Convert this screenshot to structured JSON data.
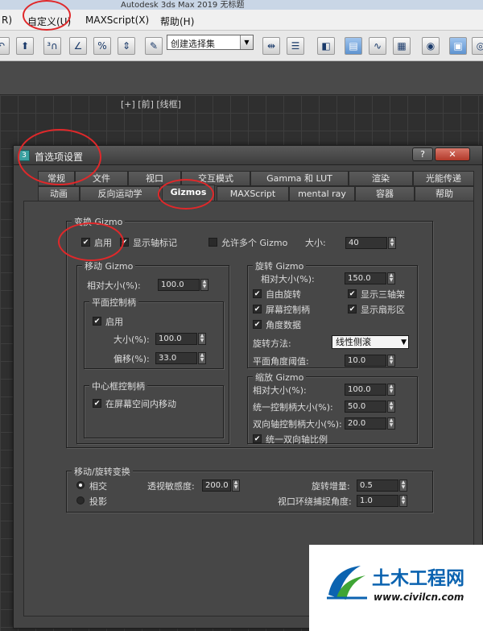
{
  "app": {
    "window_title": "Autodesk 3ds Max 2019    无标题"
  },
  "menubar": {
    "items": [
      "R)",
      "自定义(U)",
      "MAXScript(X)",
      "帮助(H)"
    ]
  },
  "toolbar": {
    "selection_set_value": "创建选择集",
    "icons": [
      "undo-icon",
      "upload-icon",
      "snap-3-icon",
      "angle-snap-icon",
      "percent-snap-icon",
      "spinner-snap-icon",
      "edit-named-selection-icon",
      "mirror-icon",
      "align-icon",
      "layer-icon",
      "scene-explorer-icon",
      "curve-editor-icon",
      "schematic-icon",
      "material-editor-icon",
      "render-setup-icon",
      "render-icon"
    ]
  },
  "viewport": {
    "label": "[+] [前] [线框]"
  },
  "dialog": {
    "title": "首选项设置",
    "help_button": "?",
    "close_button": "✕",
    "tabs_row1": [
      "常规",
      "文件",
      "视口",
      "交互模式",
      "Gamma 和 LUT",
      "渲染",
      "光能传递"
    ],
    "tabs_row2": [
      "动画",
      "反向运动学",
      "Gizmos",
      "MAXScript",
      "mental ray",
      "容器",
      "帮助"
    ],
    "active_tab": "Gizmos",
    "transform_gizmo": {
      "group_label": "变换 Gizmo",
      "enable_label": "启用",
      "enable_checked": true,
      "show_axis_label": "显示轴标记",
      "show_axis_checked": true,
      "allow_multiple_label": "允许多个 Gizmo",
      "allow_multiple_checked": false,
      "size_label": "大小:",
      "size_value": "40"
    },
    "move_gizmo": {
      "group_label": "移动 Gizmo",
      "relative_size_label": "相对大小(%):",
      "relative_size_value": "100.0",
      "plane_handles": {
        "group_label": "平面控制柄",
        "enable_label": "启用",
        "enable_checked": true,
        "size_label": "大小(%):",
        "size_value": "100.0",
        "offset_label": "偏移(%):",
        "offset_value": "33.0"
      },
      "center_handle": {
        "group_label": "中心框控制柄",
        "screen_space_label": "在屏幕空间内移动",
        "screen_space_checked": true
      }
    },
    "rotate_gizmo": {
      "group_label": "旋转 Gizmo",
      "relative_size_label": "相对大小(%):",
      "relative_size_value": "150.0",
      "free_rotate_label": "自由旋转",
      "free_rotate_checked": true,
      "show_three_axis_label": "显示三轴架",
      "show_three_axis_checked": true,
      "screen_handle_label": "屏幕控制柄",
      "screen_handle_checked": true,
      "show_sector_label": "显示扇形区",
      "show_sector_checked": true,
      "angle_data_label": "角度数据",
      "angle_data_checked": true,
      "method_label": "旋转方法:",
      "method_value": "线性侧滚",
      "plane_angle_label": "平面角度阈值:",
      "plane_angle_value": "10.0"
    },
    "scale_gizmo": {
      "group_label": "缩放 Gizmo",
      "relative_size_label": "相对大小(%):",
      "relative_size_value": "100.0",
      "uniform_handle_label": "统一控制柄大小(%):",
      "uniform_handle_value": "50.0",
      "dual_axis_label": "双向轴控制柄大小(%):",
      "dual_axis_value": "20.0",
      "uniform_dual_label": "统一双向轴比例",
      "uniform_dual_checked": true
    },
    "move_rotate_transform": {
      "group_label": "移动/旋转变换",
      "intersect_label": "相交",
      "intersect_selected": true,
      "project_label": "投影",
      "project_selected": false,
      "perspective_label": "透视敏感度:",
      "perspective_value": "200.0",
      "rotate_increment_label": "旋转增量:",
      "rotate_increment_value": "0.5",
      "orbit_snap_label": "视口环绕捕捉角度:",
      "orbit_snap_value": "1.0"
    }
  },
  "watermark": {
    "name": "土木工程网",
    "url": "www.civilcn.com"
  },
  "colors": {
    "annotation_red": "#e0282a",
    "watermark_blue": "#0b63b0",
    "dialog_bg": "#474747"
  }
}
